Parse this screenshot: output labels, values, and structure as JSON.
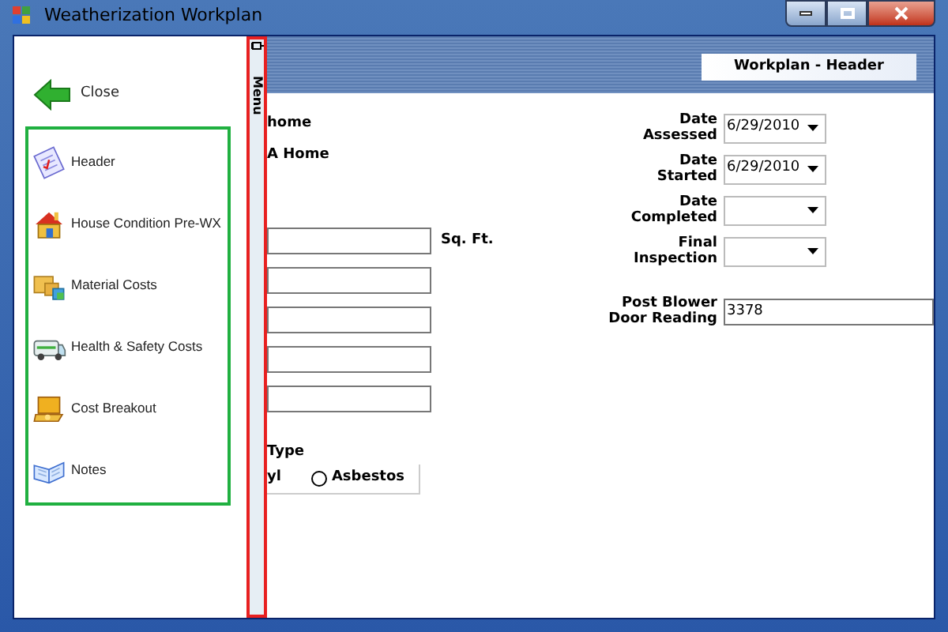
{
  "window": {
    "title": "Weatherization Workplan"
  },
  "left_panel": {
    "close": {
      "label": "Close"
    },
    "menu_items": [
      {
        "label": "Header"
      },
      {
        "label": "House Condition Pre-WX"
      },
      {
        "label": "Material Costs"
      },
      {
        "label": "Health & Safety Costs"
      },
      {
        "label": "Cost Breakout"
      },
      {
        "label": "Notes"
      }
    ]
  },
  "menu_strip": {
    "label": "Menu"
  },
  "header": {
    "title": "Workplan - Header"
  },
  "form_left": {
    "texts": [
      "home",
      "A Home"
    ],
    "fields": [
      {
        "kind": "text",
        "unit": "Sq. Ft."
      },
      {
        "kind": "text"
      },
      {
        "kind": "text"
      },
      {
        "kind": "text"
      },
      {
        "kind": "text"
      }
    ],
    "type_group": {
      "title": "Type",
      "options": [
        {
          "label": "yl"
        },
        {
          "label": "Asbestos",
          "selected": false
        }
      ]
    }
  },
  "form_right": [
    {
      "label": [
        "Date",
        "Assessed"
      ],
      "kind": "date",
      "value": "6/29/2010"
    },
    {
      "label": [
        "Date",
        "Started"
      ],
      "kind": "date",
      "value": "6/29/2010"
    },
    {
      "label": [
        "Date",
        "Completed"
      ],
      "kind": "date"
    },
    {
      "label": [
        "Final",
        "Inspection"
      ],
      "kind": "date"
    },
    {
      "label": [
        "Post Blower",
        "Door Reading"
      ],
      "kind": "text",
      "value": "3378"
    }
  ]
}
